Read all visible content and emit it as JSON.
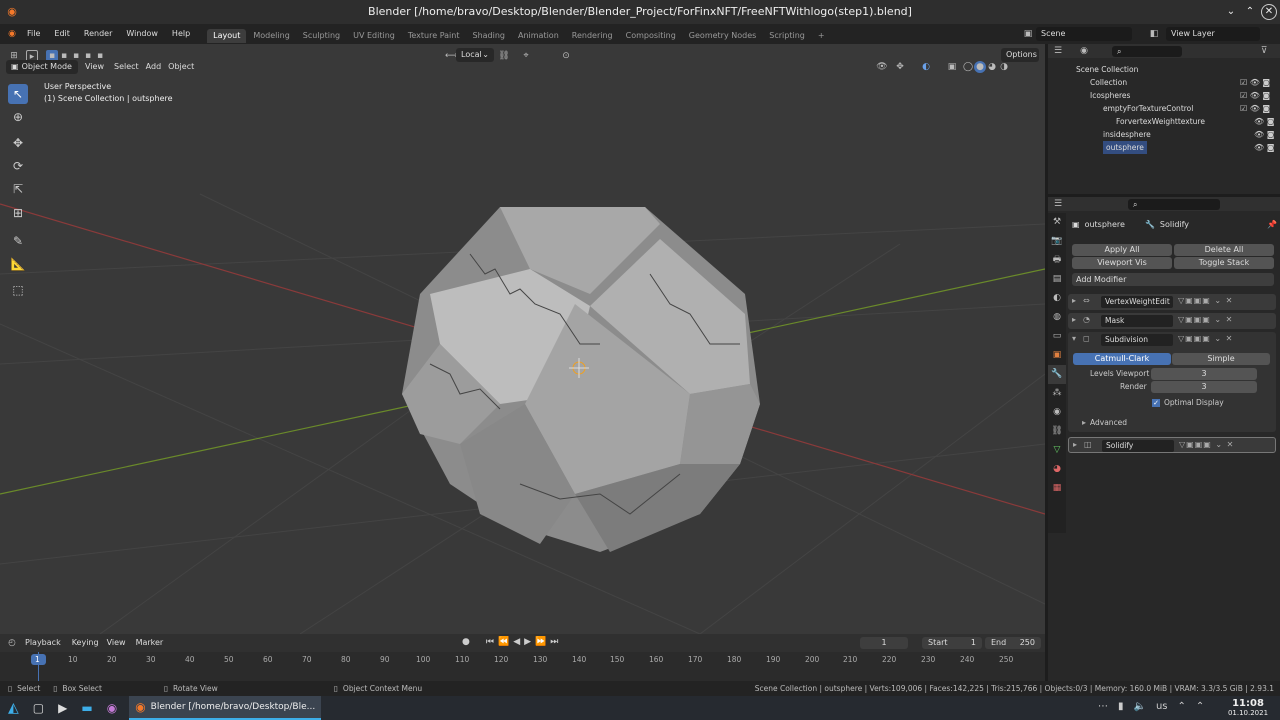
{
  "window": {
    "title": "Blender [/home/bravo/Desktop/Blender/Blender_Project/ForFinxNFT/FreeNFTWithlogo(step1).blend]"
  },
  "menus": [
    "File",
    "Edit",
    "Render",
    "Window",
    "Help"
  ],
  "workspaces": [
    "Layout",
    "Modeling",
    "Sculpting",
    "UV Editing",
    "Texture Paint",
    "Shading",
    "Animation",
    "Rendering",
    "Compositing",
    "Geometry Nodes",
    "Scripting"
  ],
  "scene": {
    "name": "Scene",
    "view_layer": "View Layer"
  },
  "viewport": {
    "mode": "Object Mode",
    "menu": [
      "View",
      "Select",
      "Add",
      "Object"
    ],
    "orientation": "Local",
    "options_label": "Options",
    "info_line1": "User Perspective",
    "info_line2": "(1) Scene Collection | outsphere"
  },
  "outliner": {
    "items": [
      {
        "label": "Scene Collection"
      },
      {
        "label": "Collection"
      },
      {
        "label": "Icospheres"
      },
      {
        "label": "emptyForTextureControl"
      },
      {
        "label": "ForvertexWeighttexture"
      },
      {
        "label": "insidesphere"
      },
      {
        "label": "outsphere"
      }
    ]
  },
  "properties": {
    "object_name": "outsphere",
    "modifier_name": "Solidify",
    "apply_all": "Apply All",
    "delete_all": "Delete All",
    "viewport_vis": "Viewport Vis",
    "toggle_stack": "Toggle Stack",
    "add_modifier": "Add Modifier",
    "modifiers": [
      {
        "name": "VertexWeightEdit"
      },
      {
        "name": "Mask"
      },
      {
        "name": "Subdivision"
      }
    ],
    "subdiv": {
      "catmull": "Catmull-Clark",
      "simple": "Simple",
      "levels_viewport_label": "Levels Viewport",
      "levels_viewport": "3",
      "render_label": "Render",
      "render": "3",
      "optimal_display": "Optimal Display",
      "advanced": "Advanced"
    },
    "solidify": "Solidify"
  },
  "timeline": {
    "menu": [
      "Playback",
      "Keying",
      "View",
      "Marker"
    ],
    "current_frame": "1",
    "start_label": "Start",
    "start": "1",
    "end_label": "End",
    "end": "250",
    "ticks": [
      "1",
      "10",
      "20",
      "30",
      "40",
      "50",
      "60",
      "70",
      "80",
      "90",
      "100",
      "110",
      "120",
      "130",
      "140",
      "150",
      "160",
      "170",
      "180",
      "190",
      "200",
      "210",
      "220",
      "230",
      "240",
      "250"
    ]
  },
  "statusbar": {
    "select": "Select",
    "box_select": "Box Select",
    "rotate_view": "Rotate View",
    "context_menu": "Object Context Menu",
    "stats": "Scene Collection | outsphere | Verts:109,006 | Faces:142,225 | Tris:215,766 | Objects:0/3 | Memory: 160.0 MiB | VRAM: 3.3/3.5 GiB | 2.93.1"
  },
  "taskbar": {
    "app_label": "Blender [/home/bravo/Desktop/Ble...",
    "lang": "us",
    "time": "11:08",
    "date": "01.10.2021"
  }
}
